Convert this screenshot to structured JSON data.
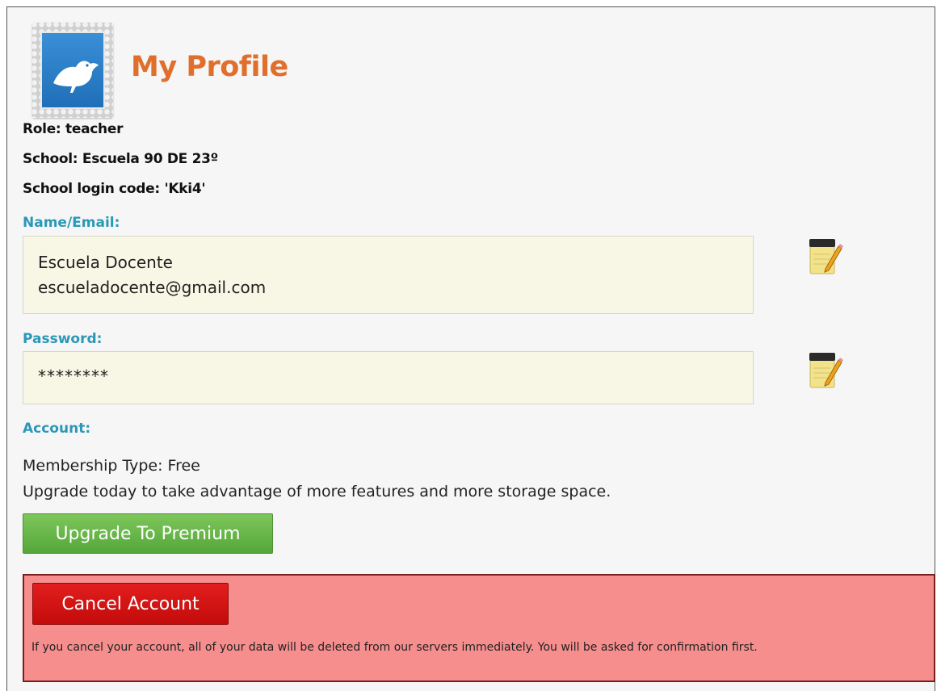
{
  "page": {
    "title": "My Profile"
  },
  "info": {
    "role": "Role: teacher",
    "school": "School: Escuela 90 DE 23º",
    "login_code": "School login code: 'Kki4'"
  },
  "name_email": {
    "label": "Name/Email:",
    "name": "Escuela Docente",
    "email": "escueladocente@gmail.com",
    "edit_icon": "edit-notepad-icon"
  },
  "password": {
    "label": "Password:",
    "value": "********",
    "edit_icon": "edit-notepad-icon"
  },
  "account": {
    "label": "Account:",
    "membership": "Membership Type: Free",
    "upgrade_text": "Upgrade today to take advantage of more features and more storage space.",
    "upgrade_button": "Upgrade To Premium"
  },
  "cancel": {
    "button": "Cancel Account",
    "note": "If you cancel your account, all of your data will be deleted from our servers immediately. You will be asked for confirmation first."
  },
  "colors": {
    "title": "#e06f2b",
    "section_label": "#2b98b6",
    "field_bg": "#f8f6e4",
    "upgrade_button": "#5fb043",
    "cancel_button": "#d01414",
    "danger_bg": "#f78e8e"
  },
  "icons": {
    "logo": "bird-stamp-icon"
  }
}
